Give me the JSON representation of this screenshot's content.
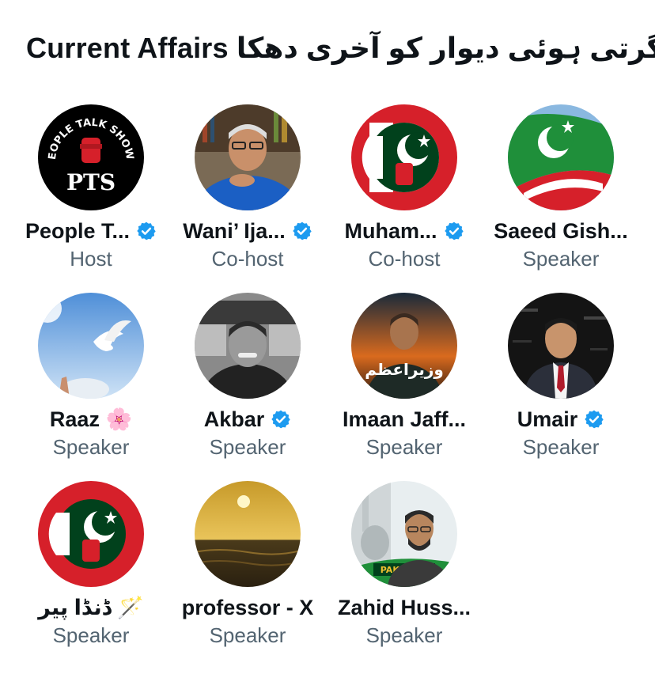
{
  "space": {
    "title": "Current Affairs گرتی ہوئی دیوار کو آخری دھکا"
  },
  "participants": [
    {
      "name": "People T...",
      "role": "Host",
      "verified": true,
      "avatar": "pts-logo"
    },
    {
      "name": "Wani’ Ija...",
      "role": "Co-host",
      "verified": true,
      "avatar": "man-photo-blue-shirt"
    },
    {
      "name": "Muham...",
      "role": "Co-host",
      "verified": true,
      "avatar": "flag-badge-red"
    },
    {
      "name": "Saeed Gish...",
      "role": "Speaker",
      "verified": false,
      "avatar": "pti-flag"
    },
    {
      "name": "Raaz 🌸",
      "role": "Speaker",
      "verified": false,
      "avatar": "dove-sky"
    },
    {
      "name": "Akbar",
      "role": "Speaker",
      "verified": true,
      "avatar": "man-photo-bw"
    },
    {
      "name": "Imaan Jaff...",
      "role": "Speaker",
      "verified": false,
      "avatar": "leader-poster"
    },
    {
      "name": "Umair",
      "role": "Speaker",
      "verified": true,
      "avatar": "man-photo-dark"
    },
    {
      "name": "ڈنڈا پیر 🪄",
      "role": "Speaker",
      "verified": false,
      "avatar": "flag-badge-red"
    },
    {
      "name": "professor - X",
      "role": "Speaker",
      "verified": false,
      "avatar": "sunset-sea"
    },
    {
      "name": "Zahid Huss...",
      "role": "Speaker",
      "verified": false,
      "avatar": "pakistan-poster"
    }
  ],
  "colors": {
    "verified": "#1d9bf0",
    "text": "#0f1419",
    "secondary": "#536471",
    "pak_green": "#01411c",
    "red": "#d6202a"
  },
  "avatar_text": {
    "pts_arc": "PEOPLE TALK SHOWS",
    "pts_mark": "PTS",
    "leader_caption": "وزیراعظم",
    "pakistan_banner": "PAKISTAN"
  }
}
